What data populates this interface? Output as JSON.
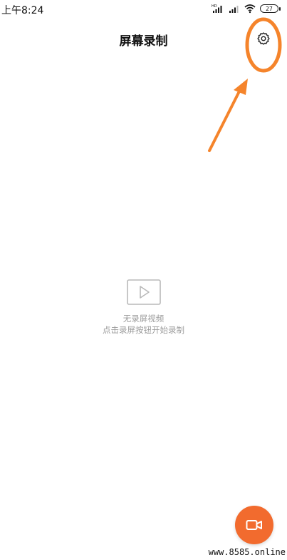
{
  "status_bar": {
    "time": "上午8:24",
    "battery": "27",
    "signal_badge": "HD"
  },
  "header": {
    "title": "屏幕录制",
    "settings_icon": "gear-icon"
  },
  "empty_state": {
    "icon": "video-play-icon",
    "title": "无录屏视频",
    "hint": "点击录屏按钮开始录制"
  },
  "fab": {
    "icon": "video-camera-icon"
  },
  "annotation": {
    "color": "#f5842b"
  },
  "watermark": "www.8585.online",
  "colors": {
    "accent": "#f26b2e",
    "muted_text": "#9b9b9b"
  }
}
